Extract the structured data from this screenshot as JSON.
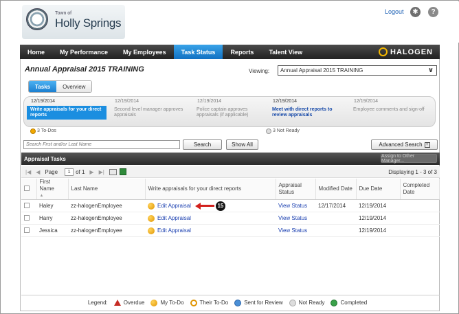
{
  "header": {
    "town_small": "Town of",
    "town_name": "Holly Springs",
    "logout": "Logout",
    "gear_glyph": "✱",
    "help_glyph": "?"
  },
  "nav": {
    "items": [
      "Home",
      "My Performance",
      "My Employees",
      "Task Status",
      "Reports",
      "Talent View"
    ],
    "active": "Task Status",
    "brand": "HALOGEN"
  },
  "page": {
    "title": "Annual Appraisal 2015 TRAINING",
    "viewing_label": "Viewing:",
    "viewing_value": "Annual Appraisal 2015 TRAINING"
  },
  "tabs": [
    "Tasks",
    "Overview"
  ],
  "steps": [
    {
      "date": "12/19/2014",
      "label": "Write appraisals for your direct reports"
    },
    {
      "date": "12/19/2014",
      "label": "Second level manager approves appraisals"
    },
    {
      "date": "12/19/2014",
      "label": "Police captain approves appraisals (if applicable)"
    },
    {
      "date": "12/19/2014",
      "label": "Meet with direct reports to review appraisals"
    },
    {
      "date": "12/19/2014",
      "label": "Employee comments and sign-off"
    }
  ],
  "counts": {
    "todos": "3 To-Dos",
    "not_ready": "3 Not Ready"
  },
  "search": {
    "placeholder": "Search First and/or Last Name",
    "search_btn": "Search",
    "show_all_btn": "Show All",
    "advanced_btn": "Advanced Search",
    "advanced_plus": "+"
  },
  "panel": {
    "title": "Appraisal Tasks",
    "assign_btn": "Assign to Other Manager..."
  },
  "pager": {
    "page_label": "Page",
    "page_value": "1",
    "of_label": "of 1",
    "displaying": "Displaying 1 - 3 of 3"
  },
  "table": {
    "headers": [
      "First Name",
      "Last Name",
      "Write appraisals for your direct reports",
      "Appraisal Status",
      "Modified Date",
      "Due Date",
      "Completed Date"
    ],
    "rows": [
      {
        "first": "Haley",
        "last": "zz-halogenEmployee",
        "action": "Edit Appraisal",
        "status": "View Status",
        "modified": "12/17/2014",
        "due": "12/19/2014",
        "completed": ""
      },
      {
        "first": "Harry",
        "last": "zz-halogenEmployee",
        "action": "Edit Appraisal",
        "status": "View Status",
        "modified": "",
        "due": "12/19/2014",
        "completed": ""
      },
      {
        "first": "Jessica",
        "last": "zz-halogenEmployee",
        "action": "Edit Appraisal",
        "status": "View Status",
        "modified": "",
        "due": "12/19/2014",
        "completed": ""
      }
    ],
    "callout_number": "15"
  },
  "legend": {
    "label": "Legend:",
    "items": [
      "Overdue",
      "My To-Do",
      "Their To-Do",
      "Sent for Review",
      "Not Ready",
      "Completed"
    ]
  },
  "colors": {
    "nav_active": "#1b8ee0",
    "link": "#1a3fb0",
    "callout_arrow": "#d2201c"
  }
}
